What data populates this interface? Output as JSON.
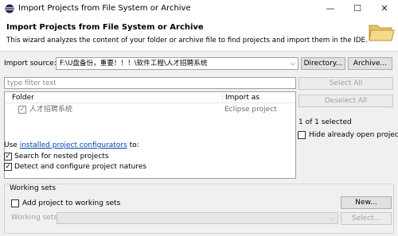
{
  "window": {
    "title": "Import Projects from File System or Archive",
    "minimize_glyph": "—",
    "maximize_glyph": "☐",
    "close_glyph": "✕"
  },
  "banner": {
    "title": "Import Projects from File System or Archive",
    "description": "This wizard analyzes the content of your folder or archive file to find projects and import them in the IDE."
  },
  "import_source": {
    "label": "Import source:",
    "value": "F:\\U盘备份，重要！！！\\软件工程\\人才招聘系统",
    "directory_button": "Directory...",
    "archive_button": "Archive..."
  },
  "filter": {
    "placeholder": "type filter text"
  },
  "table": {
    "columns": [
      "Folder",
      "Import as"
    ],
    "rows": [
      {
        "folder": "人才招聘系统",
        "import_as": "Eclipse project",
        "checked": true
      }
    ]
  },
  "side": {
    "select_all": "Select All",
    "deselect_all": "Deselect All",
    "selected_count": "1 of 1 selected",
    "hide_open": "Hide already open projects"
  },
  "options": {
    "use_prefix": "Use",
    "configurators_link": "installed project configurators",
    "use_suffix": "to:",
    "search_nested": "Search for nested projects",
    "detect_configure": "Detect and configure project natures"
  },
  "working_sets": {
    "group_label": "Working sets",
    "add_to": "Add project to working sets",
    "new_button": "New...",
    "sets_label": "Working sets:",
    "select_button": "Select..."
  },
  "icons": {
    "app": "eclipse-icon",
    "banner": "folder-icon",
    "check": "checkmark-icon",
    "dropdown": "chevron-down-icon"
  },
  "colors": {
    "link": "#0645ad",
    "dialog_bg": "#f0f0f0",
    "default_button_border": "#2d7bd6"
  }
}
